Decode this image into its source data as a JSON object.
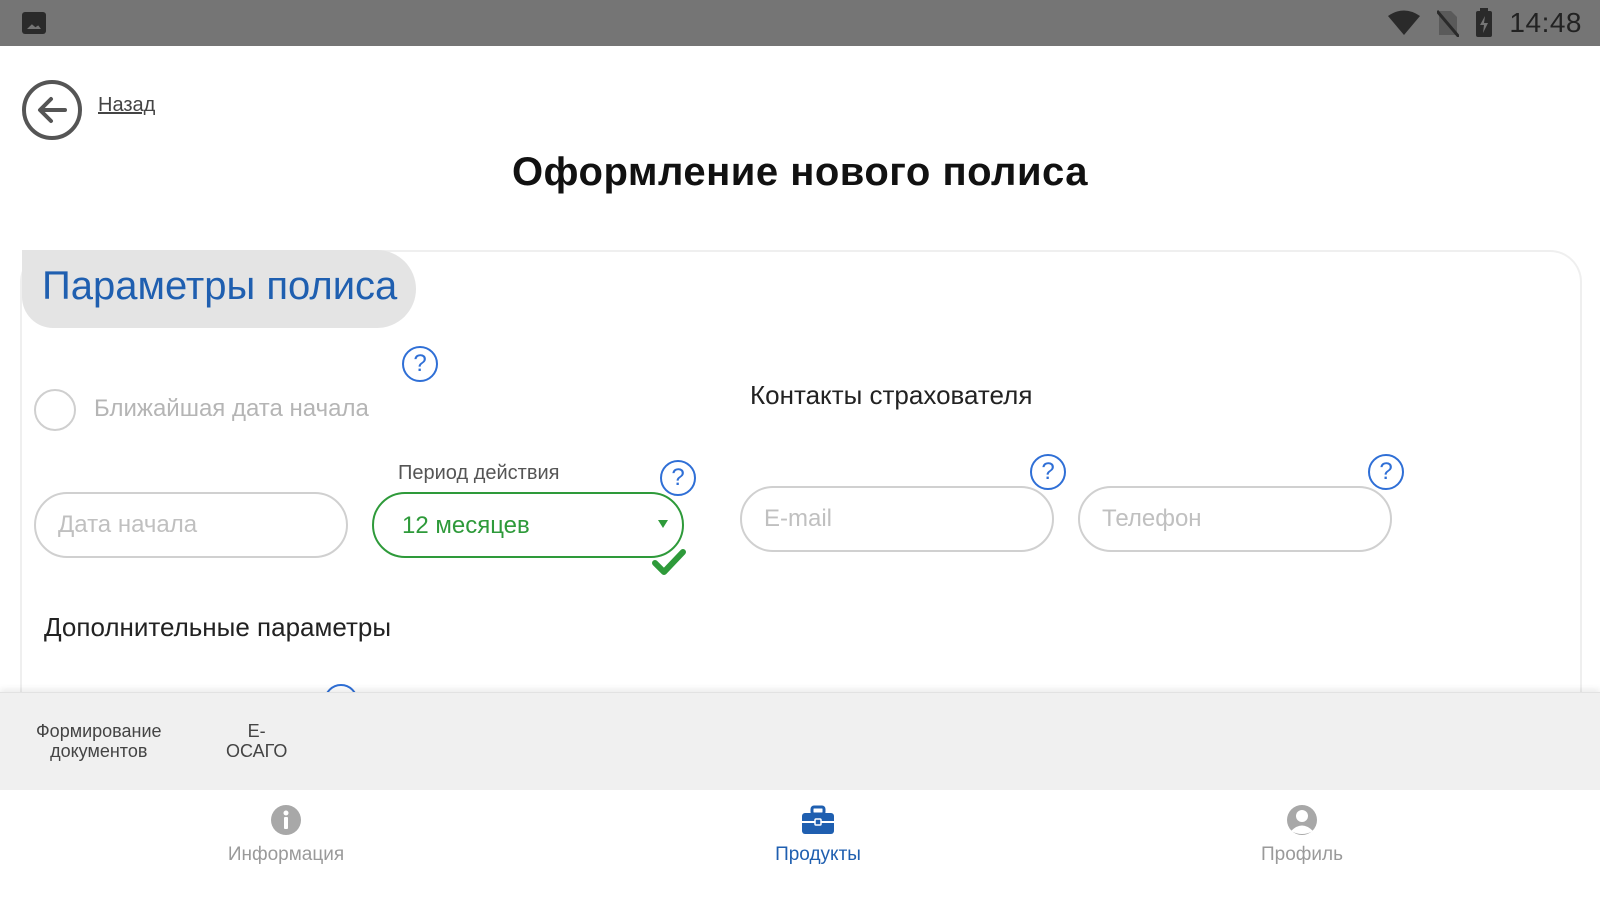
{
  "status_bar": {
    "time": "14:48"
  },
  "header": {
    "back_label": "Назад",
    "title": "Оформление нового полиса"
  },
  "policy_params": {
    "section_title": "Параметры полиса",
    "nearest_start_date_label": "Ближайшая дата начала",
    "nearest_start_date_checked": false,
    "start_date_placeholder": "Дата начала",
    "period_label": "Период действия",
    "period_value": "12 месяцев",
    "period_valid": true
  },
  "contacts": {
    "heading": "Контакты страхователя",
    "email_placeholder": "E-mail",
    "phone_placeholder": "Телефон"
  },
  "additional": {
    "heading": "Дополнительные параметры"
  },
  "doc_bar": {
    "items": [
      "Формирование документов",
      "Е-ОСАГО"
    ],
    "item_lines": [
      [
        "Формирование",
        "документов"
      ],
      [
        "Е-",
        "ОСАГО"
      ]
    ]
  },
  "bottom_nav": {
    "items": [
      {
        "label": "Информация",
        "icon": "info-icon",
        "active": false
      },
      {
        "label": "Продукты",
        "icon": "briefcase-icon",
        "active": true
      },
      {
        "label": "Профиль",
        "icon": "profile-icon",
        "active": false
      }
    ]
  },
  "help_icon_glyph": "?",
  "colors": {
    "accent_blue": "#1f5fb0",
    "help_blue": "#2f6fd6",
    "valid_green": "#2e9a3a",
    "status_bar": "#757575"
  }
}
